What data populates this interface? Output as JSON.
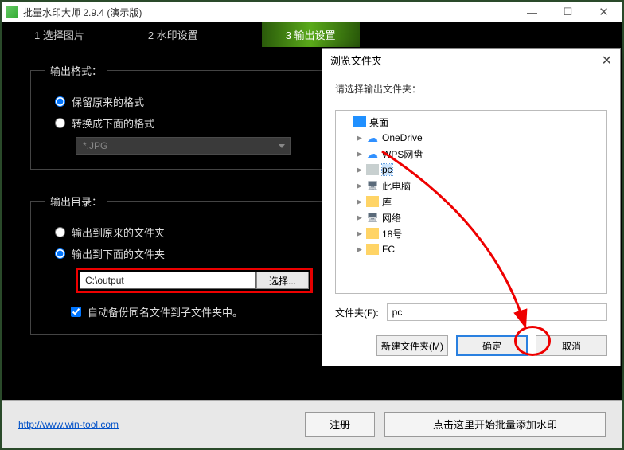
{
  "window": {
    "title": "批量水印大师 2.9.4 (演示版)"
  },
  "steps": {
    "s1": "1 选择图片",
    "s2": "2 水印设置",
    "s3": "3 输出设置"
  },
  "format_panel": {
    "legend": "输出格式：",
    "opt_keep": "保留原来的格式",
    "opt_convert": "转换成下面的格式",
    "dropdown": "*.JPG"
  },
  "dir_panel": {
    "legend": "输出目录：",
    "opt_original": "输出到原来的文件夹",
    "opt_below": "输出到下面的文件夹",
    "path": "C:\\output",
    "browse": "选择...",
    "backup": "自动备份同名文件到子文件夹中。"
  },
  "footer": {
    "url": "http://www.win-tool.com",
    "register": "注册",
    "start": "点击这里开始批量添加水印"
  },
  "dialog": {
    "title": "浏览文件夹",
    "prompt": "请选择输出文件夹：",
    "tree": {
      "root": "桌面",
      "items": [
        {
          "label": "OneDrive",
          "icon": "cloud"
        },
        {
          "label": "WPS网盘",
          "icon": "cloud"
        },
        {
          "label": "pc",
          "icon": "pc",
          "selected": true
        },
        {
          "label": "此电脑",
          "icon": "computer"
        },
        {
          "label": "库",
          "icon": "folder"
        },
        {
          "label": "网络",
          "icon": "computer"
        },
        {
          "label": "18号",
          "icon": "folder"
        },
        {
          "label": "FC",
          "icon": "folder"
        }
      ]
    },
    "folder_label": "文件夹(F):",
    "folder_value": "pc",
    "new_folder": "新建文件夹(M)",
    "ok": "确定",
    "cancel": "取消"
  }
}
